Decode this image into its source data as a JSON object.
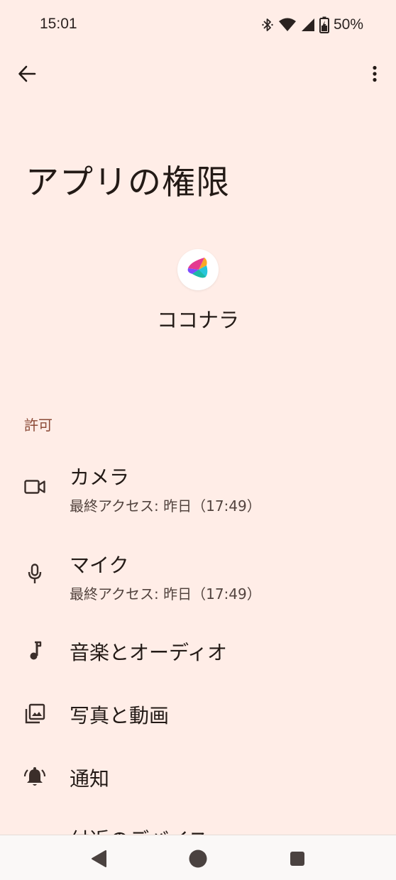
{
  "status_bar": {
    "time": "15:01",
    "battery": "50%",
    "icons": [
      "bluetooth-icon",
      "wifi-icon",
      "signal-icon",
      "battery-charging-icon"
    ]
  },
  "toolbar": {
    "back_icon": "arrow-back-icon",
    "more_icon": "more-vert-icon"
  },
  "page": {
    "title": "アプリの権限"
  },
  "app": {
    "name": "ココナラ",
    "icon": "coconala-logo-icon"
  },
  "section": {
    "header": "許可"
  },
  "permissions": [
    {
      "title": "カメラ",
      "subtitle": "最終アクセス: 昨日（17:49）",
      "icon": "videocam-icon"
    },
    {
      "title": "マイク",
      "subtitle": "最終アクセス: 昨日（17:49）",
      "icon": "mic-icon"
    },
    {
      "title": "音楽とオーディオ",
      "icon": "music-note-icon"
    },
    {
      "title": "写真と動画",
      "icon": "photo-library-icon"
    },
    {
      "title": "通知",
      "icon": "notifications-active-icon"
    },
    {
      "title": "付近のデバイス",
      "icon": "nearby-devices-icon"
    }
  ],
  "nav_bar": {
    "icons": [
      "nav-back-icon",
      "nav-home-icon",
      "nav-recents-icon"
    ]
  },
  "colors": {
    "background": "#FFEDE7",
    "section_header": "#8B4A37",
    "text_primary": "#231A16",
    "text_secondary": "#52433E"
  }
}
